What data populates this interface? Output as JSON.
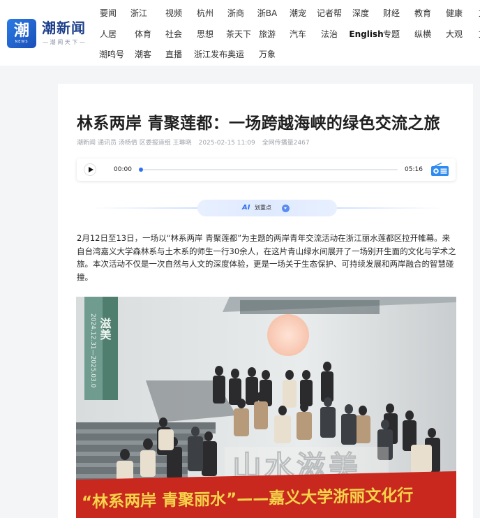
{
  "site": {
    "logo_glyph": "潮",
    "logo_sub": "NEWS",
    "name": "潮新闻",
    "slogan": "— 潮 闻 天 下 —"
  },
  "nav": {
    "row1": [
      "要闻",
      "浙江",
      "视频",
      "杭州",
      "浙商",
      "浙BA",
      "潮宠",
      "记者帮",
      "深度",
      "财经",
      "教育",
      "健康",
      "文"
    ],
    "row2": [
      "人居",
      "体育",
      "社会",
      "思想",
      "茶天下",
      "旅游",
      "汽车",
      "法治",
      "English",
      "专题",
      "纵横",
      "大观",
      "文"
    ],
    "row3": [
      "潮鸣号",
      "潮客",
      "直播",
      "浙江发布",
      "奥运",
      "万象"
    ]
  },
  "article": {
    "title": "林系两岸 青聚莲都：一场跨越海峡的绿色交流之旅",
    "meta": {
      "source": "潮新闻",
      "authors": "通讯员 汤杨倩 区委报道组 王琳晓",
      "datetime": "2025-02-15 11:09",
      "views_label": "全网传播量",
      "views": "2467"
    },
    "audio": {
      "current_time": "00:00",
      "duration": "05:16",
      "progress": 0
    },
    "ai": {
      "badge": "AI",
      "label": "划重点"
    },
    "paragraph": "2月12日至13日，一场以“林系两岸 青聚莲都”为主题的两岸青年交流活动在浙江丽水莲都区拉开帷幕。来自台湾嘉义大学森林系与土木系的师生一行30余人，在这片青山绿水间展开了一场别开生面的文化与学术之旅。本次活动不仅是一次自然与人文的深度体验，更是一场关于生态保护、可持续发展和两岸融合的智慧碰撞。",
    "photo": {
      "sign_text": "山水滋美",
      "banner_text": "“林系两岸 青聚丽水”——嘉义大学浙丽文化行",
      "poster_text": "2024.12.31—2025.03.0",
      "poster_title": "滋美"
    }
  },
  "colors": {
    "brand_blue": "#1d3f8c",
    "accent_blue": "#2f72f0",
    "banner_red": "#c8281e",
    "banner_text": "#f5d34a"
  }
}
